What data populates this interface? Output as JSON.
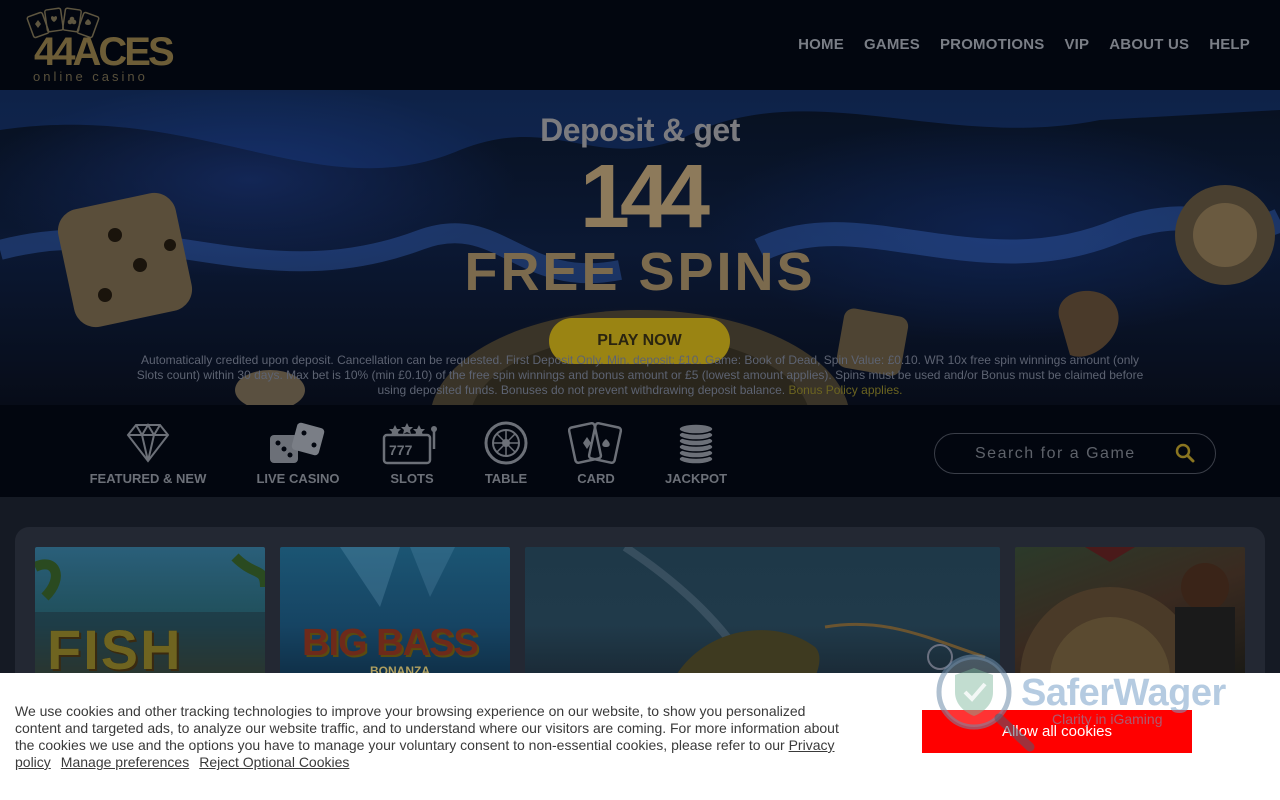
{
  "header": {
    "logo_text": "44ACES",
    "logo_sub": "online casino",
    "nav": [
      "HOME",
      "GAMES",
      "PROMOTIONS",
      "VIP",
      "ABOUT US",
      "HELP"
    ]
  },
  "hero": {
    "headline": "Deposit & get",
    "number": "144",
    "subheadline": "FREE  SPINS",
    "cta": "PLAY NOW",
    "terms": "Automatically credited upon deposit. Cancellation can be requested. First Deposit Only. Min. deposit: £10. Game: Book of Dead, Spin Value: £0.10. WR 10x free spin winnings amount (only Slots count) within 30 days. Max bet is 10% (min £0.10) of the free spin winnings and bonus amount or £5 (lowest amount applies). Spins must be used and/or Bonus must be claimed before using deposited funds. Bonuses do not prevent withdrawing deposit balance. ",
    "terms_link": "Bonus Policy applies."
  },
  "categories": [
    {
      "label": "FEATURED & NEW",
      "icon": "diamond-icon"
    },
    {
      "label": "LIVE CASINO",
      "icon": "dice-icon"
    },
    {
      "label": "SLOTS",
      "icon": "slot-machine-icon"
    },
    {
      "label": "TABLE",
      "icon": "roulette-icon"
    },
    {
      "label": "CARD",
      "icon": "cards-icon"
    },
    {
      "label": "JACKPOT",
      "icon": "chip-stack-icon"
    }
  ],
  "search": {
    "placeholder": "Search for a Game",
    "icon": "search-icon"
  },
  "games": [
    {
      "title": "FISH"
    },
    {
      "title": "BIG BASS",
      "subtitle": "BONANZA"
    },
    {
      "title": ""
    },
    {
      "title": ""
    }
  ],
  "cookie": {
    "text": "We use cookies and other tracking technologies to improve your browsing experience on our website, to show you personalized content and targeted ads, to analyze our website traffic, and to understand where our visitors are coming. For more information about the cookies we use and the options you have to manage your voluntary consent to non-essential cookies, please refer to our ",
    "privacy_link": "Privacy policy",
    "manage_link": "Manage preferences",
    "reject_link": "Reject Optional Cookies",
    "allow_button": "Allow all cookies"
  },
  "watermark": {
    "name": "SaferWager",
    "tagline": "Clarity in iGaming"
  },
  "colors": {
    "header_bg": "#02060f",
    "gold": "#9a8413",
    "allow_button": "#ff0000",
    "nav_text": "#7a7e86"
  }
}
